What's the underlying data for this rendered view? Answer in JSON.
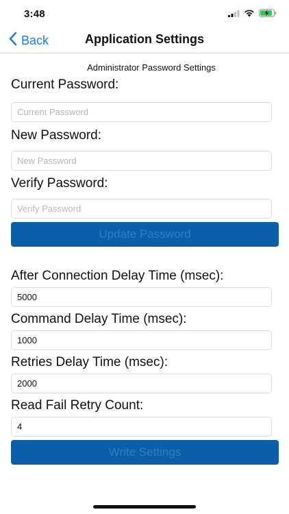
{
  "status_bar": {
    "time": "3:48"
  },
  "nav": {
    "back_label": "Back",
    "title": "Application Settings"
  },
  "password_section": {
    "header": "Administrator Password Settings",
    "current": {
      "label": "Current Password:",
      "placeholder": "Current Password",
      "value": ""
    },
    "new": {
      "label": "New Password:",
      "placeholder": "New Password",
      "value": ""
    },
    "verify": {
      "label": "Verify Password:",
      "placeholder": "Verify Password",
      "value": ""
    },
    "update_button": "Update Password"
  },
  "settings_section": {
    "connection_delay": {
      "label": "After Connection Delay Time (msec):",
      "value": "5000"
    },
    "command_delay": {
      "label": "Command  Delay Time (msec):",
      "value": "1000"
    },
    "retries_delay": {
      "label": "Retries  Delay Time (msec):",
      "value": "2000"
    },
    "retry_count": {
      "label": "Read Fail Retry Count:",
      "value": "4"
    },
    "write_button": "Write Settings"
  },
  "colors": {
    "accent": "#1a7cf5",
    "button_bg": "#0b5ea8",
    "button_text_disabled": "#2f7dc4"
  }
}
